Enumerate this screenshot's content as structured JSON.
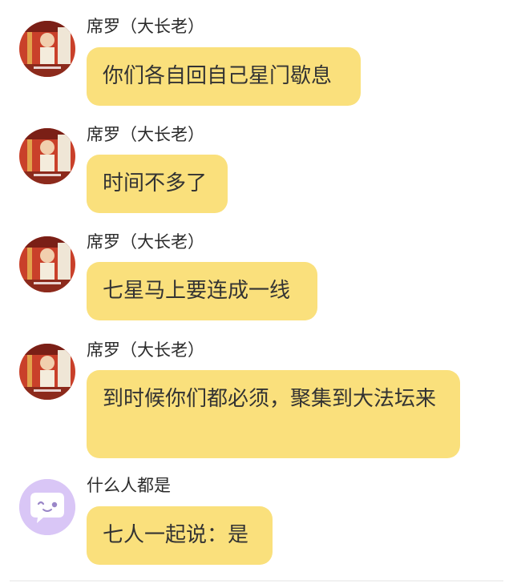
{
  "messages": [
    {
      "sender": "席罗（大长老）",
      "text": "你们各自回自己星门歇息",
      "avatar": "elder-portrait"
    },
    {
      "sender": "席罗（大长老）",
      "text": "时间不多了",
      "avatar": "elder-portrait"
    },
    {
      "sender": "席罗（大长老）",
      "text": "七星马上要连成一线",
      "avatar": "elder-portrait"
    },
    {
      "sender": "席罗（大长老）",
      "text": "到时候你们都必须，聚集到大法坛来",
      "avatar": "elder-portrait"
    },
    {
      "sender": "什么人都是",
      "text": "七人一起说：是",
      "avatar": "chat-bubble-face-icon"
    }
  ],
  "colors": {
    "bubble": "#fae07c",
    "avatar_purple": "#d9c6f6"
  }
}
